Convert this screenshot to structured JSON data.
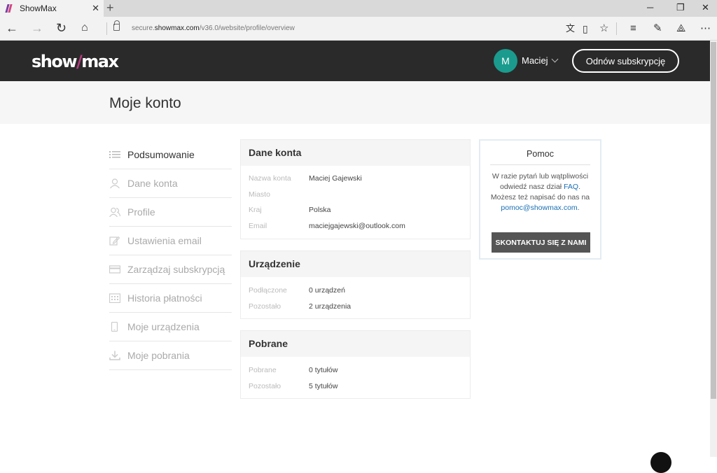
{
  "browser": {
    "tab_title": "ShowMax",
    "new_tab": "+",
    "url_prefix": "secure.",
    "url_domain": "showmax.com",
    "url_path": "/v36.0/website/profile/overview",
    "controls": {
      "minimize": "─",
      "restore": "❐",
      "close": "✕"
    }
  },
  "header": {
    "logo_left": "show",
    "logo_slash": "/",
    "logo_right": "max",
    "avatar_initial": "M",
    "user_name": "Maciej",
    "renew_label": "Odnów subskrypcję"
  },
  "page": {
    "title": "Moje konto"
  },
  "sidebar": {
    "items": [
      {
        "label": "Podsumowanie",
        "icon": "list-icon",
        "active": true
      },
      {
        "label": "Dane konta",
        "icon": "user-icon"
      },
      {
        "label": "Profile",
        "icon": "users-icon"
      },
      {
        "label": "Ustawienia email",
        "icon": "edit-icon"
      },
      {
        "label": "Zarządzaj subskrypcją",
        "icon": "credit-card-icon"
      },
      {
        "label": "Historia płatności",
        "icon": "calendar-icon"
      },
      {
        "label": "Moje urządzenia",
        "icon": "phone-icon"
      },
      {
        "label": "Moje pobrania",
        "icon": "download-icon"
      }
    ]
  },
  "account": {
    "title": "Dane konta",
    "rows": [
      {
        "label": "Nazwa konta",
        "value": "Maciej Gajewski"
      },
      {
        "label": "Miasto",
        "value": ""
      },
      {
        "label": "Kraj",
        "value": "Polska"
      },
      {
        "label": "Email",
        "value": "maciejgajewski@outlook.com"
      }
    ]
  },
  "devices": {
    "title": "Urządzenie",
    "rows": [
      {
        "label": "Podłączone",
        "value": "0 urządzeń"
      },
      {
        "label": "Pozostało",
        "value": "2 urządzenia"
      }
    ]
  },
  "downloads": {
    "title": "Pobrane",
    "rows": [
      {
        "label": "Pobrane",
        "value": "0 tytułów"
      },
      {
        "label": "Pozostało",
        "value": "5 tytułów"
      }
    ]
  },
  "help": {
    "title": "Pomoc",
    "text_1": "W razie pytań lub wątpliwości odwiedź nasz dział ",
    "faq_link": "FAQ",
    "text_2": ". Możesz też napisać do nas na ",
    "email_link": "pomoc@showmax.com",
    "text_3": ".",
    "button_label": "SKONTAKTUJ SIĘ Z NAMI"
  }
}
